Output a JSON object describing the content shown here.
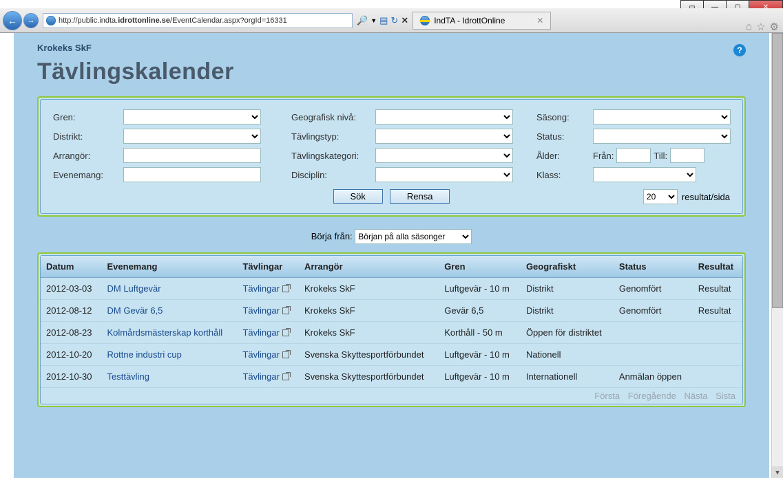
{
  "window": {
    "url_prefix": "http://public.indta.",
    "url_domain": "idrottonline.se",
    "url_path": "/EventCalendar.aspx?orgId=16331",
    "tab_title": "IndTA - IdrottOnline"
  },
  "page": {
    "org": "Krokeks SkF",
    "title": "Tävlingskalender"
  },
  "filters": {
    "gren": "Gren:",
    "distrikt": "Distrikt:",
    "arrangor": "Arrangör:",
    "evenemang": "Evenemang:",
    "geonivaa": "Geografisk nivå:",
    "tavlingstyp": "Tävlingstyp:",
    "tavlingskategori": "Tävlingskategori:",
    "disciplin": "Disciplin:",
    "sasong": "Säsong:",
    "status": "Status:",
    "alder": "Ålder:",
    "fran": "Från:",
    "till": "Till:",
    "klass": "Klass:",
    "sok": "Sök",
    "rensa": "Rensa",
    "per_page_val": "20",
    "per_page_label": "resultat/sida"
  },
  "start": {
    "label": "Börja från:",
    "value": "Början på alla säsonger"
  },
  "columns": {
    "datum": "Datum",
    "evenemang": "Evenemang",
    "tavlingar": "Tävlingar",
    "arrangor": "Arrangör",
    "gren": "Gren",
    "geogr": "Geografiskt",
    "status": "Status",
    "resultat": "Resultat"
  },
  "rows": [
    {
      "datum": "2012-03-03",
      "evenemang": "DM Luftgevär",
      "tavlingar": "Tävlingar",
      "arrangor": "Krokeks SkF",
      "gren": "Luftgevär - 10 m",
      "geogr": "Distrikt",
      "status": "Genomfört",
      "resultat": "Resultat"
    },
    {
      "datum": "2012-08-12",
      "evenemang": "DM Gevär 6,5",
      "tavlingar": "Tävlingar",
      "arrangor": "Krokeks SkF",
      "gren": "Gevär 6,5",
      "geogr": "Distrikt",
      "status": "Genomfört",
      "resultat": "Resultat"
    },
    {
      "datum": "2012-08-23",
      "evenemang": "Kolmårdsmästerskap korthåll",
      "tavlingar": "Tävlingar",
      "arrangor": "Krokeks SkF",
      "gren": "Korthåll - 50 m",
      "geogr": "Öppen för distriktet",
      "status": "",
      "resultat": ""
    },
    {
      "datum": "2012-10-20",
      "evenemang": "Rottne industri cup",
      "tavlingar": "Tävlingar",
      "arrangor": "Svenska Skyttesportförbundet",
      "gren": "Luftgevär - 10 m",
      "geogr": "Nationell",
      "status": "",
      "resultat": ""
    },
    {
      "datum": "2012-10-30",
      "evenemang": "Testtävling",
      "tavlingar": "Tävlingar",
      "arrangor": "Svenska Skyttesportförbundet",
      "gren": "Luftgevär - 10 m",
      "geogr": "Internationell",
      "status": "Anmälan öppen",
      "resultat": ""
    }
  ],
  "pager": {
    "forsta": "Första",
    "foreg": "Föregående",
    "nasta": "Nästa",
    "sista": "Sista"
  }
}
